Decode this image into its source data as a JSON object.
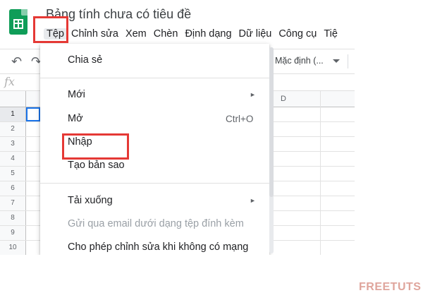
{
  "header": {
    "doc_title": "Bảng tính chưa có tiêu đề",
    "menu": [
      "Tệp",
      "Chỉnh sửa",
      "Xem",
      "Chèn",
      "Định dạng",
      "Dữ liệu",
      "Công cụ",
      "Tiệ"
    ]
  },
  "toolbar": {
    "undo_icon": "↶",
    "redo_icon": "↷",
    "font_select": "Mặc định (..."
  },
  "formula_bar": {
    "fx": "fx"
  },
  "grid": {
    "column_visible": "D",
    "rows": [
      "1",
      "2",
      "3",
      "4",
      "5",
      "6",
      "7",
      "8",
      "9",
      "10"
    ]
  },
  "file_menu": {
    "share": "Chia sẻ",
    "new": "Mới",
    "new_arrow": "►",
    "open": "Mở",
    "open_shortcut": "Ctrl+O",
    "import": "Nhập",
    "make_copy": "Tạo bản sao",
    "download": "Tải xuống",
    "download_arrow": "►",
    "email_attachment": "Gửi qua email dưới dạng tệp đính kèm",
    "offline": "Cho phép chỉnh sửa khi không có mạng"
  },
  "watermark": "FREETUTS",
  "colors": {
    "highlight_box": "#e53935",
    "sheets_green": "#0f9d58",
    "selection_blue": "#1a73e8"
  }
}
